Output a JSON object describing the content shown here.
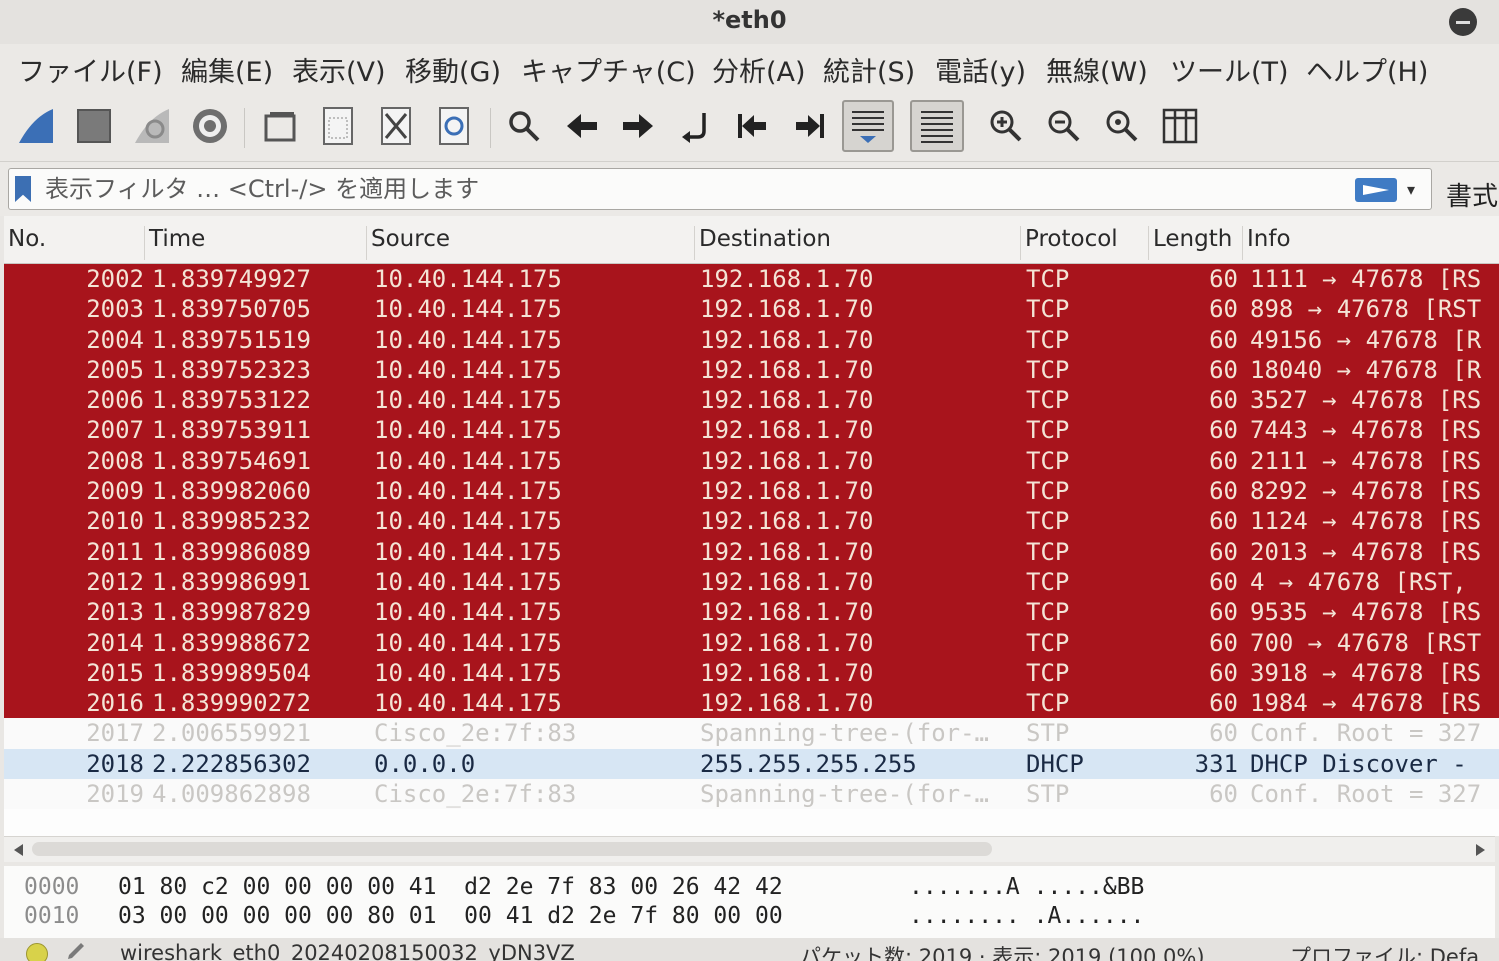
{
  "window": {
    "title": "*eth0"
  },
  "menu": [
    "ファイル(F)",
    "編集(E)",
    "表示(V)",
    "移動(G)",
    "キャプチャ(C)",
    "分析(A)",
    "統計(S)",
    "電話(y)",
    "無線(W)",
    "ツール(T)",
    "ヘルプ(H)"
  ],
  "toolbar": {
    "icons": [
      "shark-fin-icon",
      "stop-icon",
      "restart-icon",
      "capture-options-icon",
      "open-file-icon",
      "save-file-icon",
      "close-file-icon",
      "reload-file-icon",
      "search-icon",
      "back-arrow-icon",
      "forward-arrow-icon",
      "go-to-packet-icon",
      "first-packet-icon",
      "last-packet-icon",
      "autoscroll-icon",
      "colorize-icon",
      "zoom-in-icon",
      "zoom-out-icon",
      "normal-size-icon",
      "resize-columns-icon"
    ]
  },
  "filter": {
    "placeholder": "表示フィルタ … <Ctrl-/> を適用します",
    "format_label": "書式"
  },
  "columns": [
    "No.",
    "Time",
    "Source",
    "Destination",
    "Protocol",
    "Length",
    "Info"
  ],
  "packets": [
    {
      "no": "2002",
      "time": "1.839749927",
      "source": "10.40.144.175",
      "dest": "192.168.1.70",
      "proto": "TCP",
      "len": "60",
      "info": "1111 → 47678 [RS",
      "kind": "tcp"
    },
    {
      "no": "2003",
      "time": "1.839750705",
      "source": "10.40.144.175",
      "dest": "192.168.1.70",
      "proto": "TCP",
      "len": "60",
      "info": "898 → 47678 [RST",
      "kind": "tcp"
    },
    {
      "no": "2004",
      "time": "1.839751519",
      "source": "10.40.144.175",
      "dest": "192.168.1.70",
      "proto": "TCP",
      "len": "60",
      "info": "49156 → 47678 [R",
      "kind": "tcp"
    },
    {
      "no": "2005",
      "time": "1.839752323",
      "source": "10.40.144.175",
      "dest": "192.168.1.70",
      "proto": "TCP",
      "len": "60",
      "info": "18040 → 47678 [R",
      "kind": "tcp"
    },
    {
      "no": "2006",
      "time": "1.839753122",
      "source": "10.40.144.175",
      "dest": "192.168.1.70",
      "proto": "TCP",
      "len": "60",
      "info": "3527 → 47678 [RS",
      "kind": "tcp"
    },
    {
      "no": "2007",
      "time": "1.839753911",
      "source": "10.40.144.175",
      "dest": "192.168.1.70",
      "proto": "TCP",
      "len": "60",
      "info": "7443 → 47678 [RS",
      "kind": "tcp"
    },
    {
      "no": "2008",
      "time": "1.839754691",
      "source": "10.40.144.175",
      "dest": "192.168.1.70",
      "proto": "TCP",
      "len": "60",
      "info": "2111 → 47678 [RS",
      "kind": "tcp"
    },
    {
      "no": "2009",
      "time": "1.839982060",
      "source": "10.40.144.175",
      "dest": "192.168.1.70",
      "proto": "TCP",
      "len": "60",
      "info": "8292 → 47678 [RS",
      "kind": "tcp"
    },
    {
      "no": "2010",
      "time": "1.839985232",
      "source": "10.40.144.175",
      "dest": "192.168.1.70",
      "proto": "TCP",
      "len": "60",
      "info": "1124 → 47678 [RS",
      "kind": "tcp"
    },
    {
      "no": "2011",
      "time": "1.839986089",
      "source": "10.40.144.175",
      "dest": "192.168.1.70",
      "proto": "TCP",
      "len": "60",
      "info": "2013 → 47678 [RS",
      "kind": "tcp"
    },
    {
      "no": "2012",
      "time": "1.839986991",
      "source": "10.40.144.175",
      "dest": "192.168.1.70",
      "proto": "TCP",
      "len": "60",
      "info": "4 → 47678 [RST,",
      "kind": "tcp"
    },
    {
      "no": "2013",
      "time": "1.839987829",
      "source": "10.40.144.175",
      "dest": "192.168.1.70",
      "proto": "TCP",
      "len": "60",
      "info": "9535 → 47678 [RS",
      "kind": "tcp"
    },
    {
      "no": "2014",
      "time": "1.839988672",
      "source": "10.40.144.175",
      "dest": "192.168.1.70",
      "proto": "TCP",
      "len": "60",
      "info": "700 → 47678 [RST",
      "kind": "tcp"
    },
    {
      "no": "2015",
      "time": "1.839989504",
      "source": "10.40.144.175",
      "dest": "192.168.1.70",
      "proto": "TCP",
      "len": "60",
      "info": "3918 → 47678 [RS",
      "kind": "tcp"
    },
    {
      "no": "2016",
      "time": "1.839990272",
      "source": "10.40.144.175",
      "dest": "192.168.1.70",
      "proto": "TCP",
      "len": "60",
      "info": "1984 → 47678 [RS",
      "kind": "tcp"
    },
    {
      "no": "2017",
      "time": "2.006559921",
      "source": "Cisco_2e:7f:83",
      "dest": "Spanning-tree-(for-…",
      "proto": "STP",
      "len": "60",
      "info": "Conf. Root = 327",
      "kind": "stp"
    },
    {
      "no": "2018",
      "time": "2.222856302",
      "source": "0.0.0.0",
      "dest": "255.255.255.255",
      "proto": "DHCP",
      "len": "331",
      "info": "DHCP Discover -",
      "kind": "dhcp"
    },
    {
      "no": "2019",
      "time": "4.009862898",
      "source": "Cisco_2e:7f:83",
      "dest": "Spanning-tree-(for-…",
      "proto": "STP",
      "len": "60",
      "info": "Conf. Root = 327",
      "kind": "stp"
    }
  ],
  "bytes": [
    {
      "offset": "0000",
      "hex": "01 80 c2 00 00 00 00 41  d2 2e 7f 83 00 26 42 42",
      "ascii": ".......A .....&BB"
    },
    {
      "offset": "0010",
      "hex": "03 00 00 00 00 00 80 01  00 41 d2 2e 7f 80 00 00",
      "ascii": "........ .A......"
    }
  ],
  "status": {
    "file": "wireshark_eth0_20240208150032_yDN3VZ",
    "count": "パケット数: 2019 · 表示: 2019 (100.0%)",
    "profile": "プロファイル: Defa"
  },
  "colors": {
    "tcp_row": "#a8141c",
    "dhcp_row": "#d7e6f4",
    "stp_text": "#c9c7c4"
  }
}
